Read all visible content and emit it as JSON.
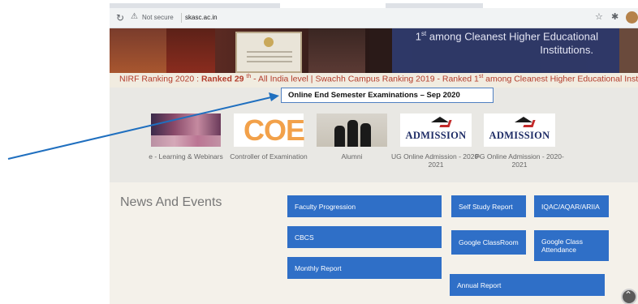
{
  "browser": {
    "reload_icon": "↻",
    "warning_icon": "⚠",
    "not_secure_label": "Not secure",
    "url": "skasc.ac.in",
    "star_icon": "☆",
    "extension_icon": "✱"
  },
  "hero": {
    "caption_sup": "st",
    "caption_line1": "among Cleanest Higher Educational",
    "caption_line2": "Institutions."
  },
  "ticker": {
    "prefix": "NIRF Ranking 2020 : ",
    "ranked_bold": "Ranked 29",
    "ranked_sup": "th",
    "middle": " - All India level | Swachh Campus Ranking 2019 - Ranked 1",
    "rank1_sup": "st",
    "suffix": " among Cleanest Higher Educational Insti"
  },
  "exam_banner": "Online End Semester Examinations – Sep 2020",
  "tiles": {
    "learning": "e - Learning & Webinars",
    "coe_logo": "COE",
    "coe": "Controller of Examination",
    "alumni": "Alumni",
    "admission_logo": "ADMISSION",
    "ug": "UG Online Admission - 2020-2021",
    "pg": "PG Online Admission - 2020-2021"
  },
  "news_heading": "News And Events",
  "buttons": {
    "faculty": "Faculty Progression",
    "ssr": "Self Study Report",
    "iqac": "IQAC/AQAR/ARIIA",
    "cbcs": "CBCS",
    "gcr": "Google ClassRoom",
    "gca": "Google Class Attendance",
    "monthly": "Monthly Report",
    "annual": "Annual Report"
  },
  "scroll_top_icon": "⌃",
  "colors": {
    "button_blue": "#2f6fc7",
    "ticker_red": "#b23b2a",
    "arrow_blue": "#1f6fbf"
  }
}
